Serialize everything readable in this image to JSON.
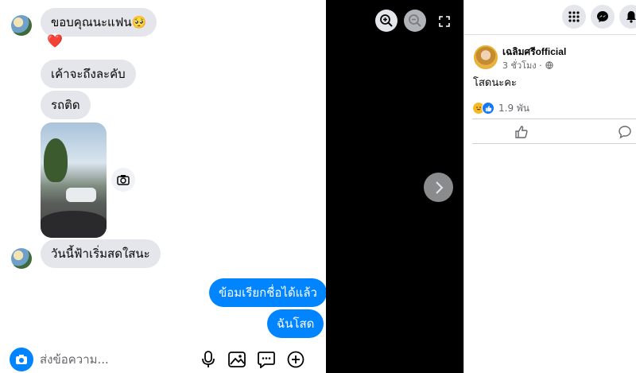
{
  "chat": {
    "messages": [
      {
        "from": "them",
        "text": "ขอบคุณนะแฟน🥺"
      },
      {
        "from": "them",
        "reaction": "❤️"
      },
      {
        "from": "them",
        "text": "เค้าจะถึงละคับ"
      },
      {
        "from": "them",
        "text": "รถติด"
      },
      {
        "from": "them",
        "type": "photo"
      },
      {
        "from": "them",
        "text": "วันนี้ฟ้าเริ่มสดใสนะ"
      },
      {
        "from": "me",
        "text": "ข้อมเรียกชื่อได้แล้ว"
      },
      {
        "from": "me",
        "text": "ฉันโสด"
      }
    ]
  },
  "composer": {
    "placeholder": "ส่งข้อความ...",
    "icons": [
      "camera-icon",
      "microphone-icon",
      "image-icon",
      "sticker-icon",
      "plus-icon"
    ]
  },
  "viewer": {
    "icons": [
      "zoom-in-icon",
      "zoom-out-icon",
      "fullscreen-icon",
      "chevron-right-icon"
    ]
  },
  "post": {
    "topbar_icons": [
      "apps-grid-icon",
      "messenger-icon",
      "notifications-icon"
    ],
    "author": "เฉลิมศรีofficial",
    "timestamp": "3 ชั่วโมง ·",
    "text": "โสดนะคะ",
    "reaction_count": "1.9 พัน",
    "actions": [
      "like-icon",
      "comment-icon"
    ]
  },
  "colors": {
    "accent": "#0084ff",
    "bubble_in": "#e4e6eb",
    "viewer_bg": "#000000"
  }
}
